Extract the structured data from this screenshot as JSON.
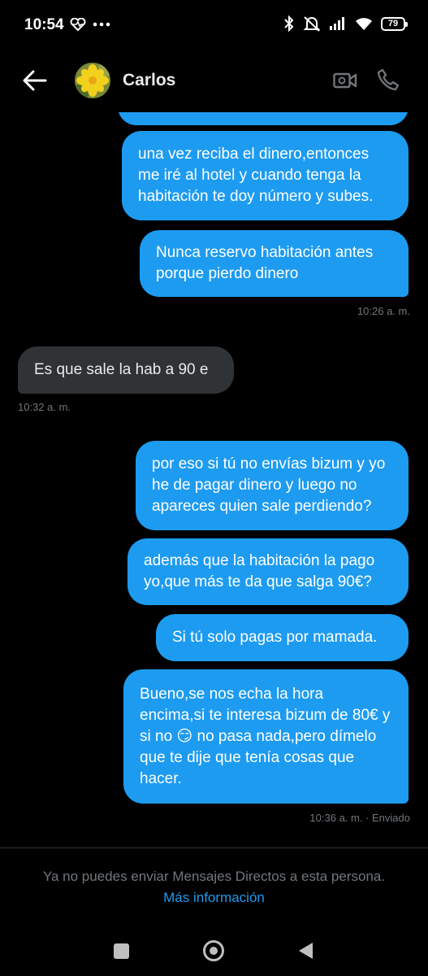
{
  "status_bar": {
    "time": "10:54",
    "battery_level": "79",
    "icons": [
      "heart-pulse-icon",
      "more-dots-icon",
      "bluetooth-icon",
      "mute-icon",
      "signal-icon",
      "wifi-icon",
      "battery-icon"
    ]
  },
  "header": {
    "contact_name": "Carlos",
    "avatar": "yellow-flower-avatar",
    "actions": [
      "video-call-icon",
      "phone-call-icon"
    ]
  },
  "messages": [
    {
      "direction": "sent",
      "text": "una vez reciba el dinero,entonces me iré al hotel y cuando tenga la habitación te doy número y subes."
    },
    {
      "direction": "sent",
      "text": "Nunca reservo habitación antes porque pierdo dinero",
      "time": "10:26 a. m."
    },
    {
      "direction": "received",
      "text": "Es que sale la hab a 90 e",
      "time": "10:32 a. m."
    },
    {
      "direction": "sent",
      "text": "por eso si tú no envías bizum y yo he de pagar dinero y luego no apareces quien sale perdiendo?"
    },
    {
      "direction": "sent",
      "text": "además que la habitación la pago yo,que más te da que salga 90€?"
    },
    {
      "direction": "sent",
      "text": "Si tú solo pagas por mamada."
    },
    {
      "direction": "sent",
      "text_parts": [
        "Bueno,se nos echa la hora encima,si te interesa bizum de 80€ y si no ",
        "😏",
        " no pasa nada,pero dímelo que te dije que tenía cosas que hacer."
      ],
      "time": "10:36 a. m. · Enviado"
    }
  ],
  "footer": {
    "notice": "Ya no puedes enviar Mensajes Directos a esta persona.",
    "link": "Más información"
  },
  "colors": {
    "sent_bubble": "#1d9bf0",
    "received_bubble": "#2f3336",
    "background": "#000000",
    "secondary_text": "#71767b",
    "link": "#1d9bf0"
  }
}
